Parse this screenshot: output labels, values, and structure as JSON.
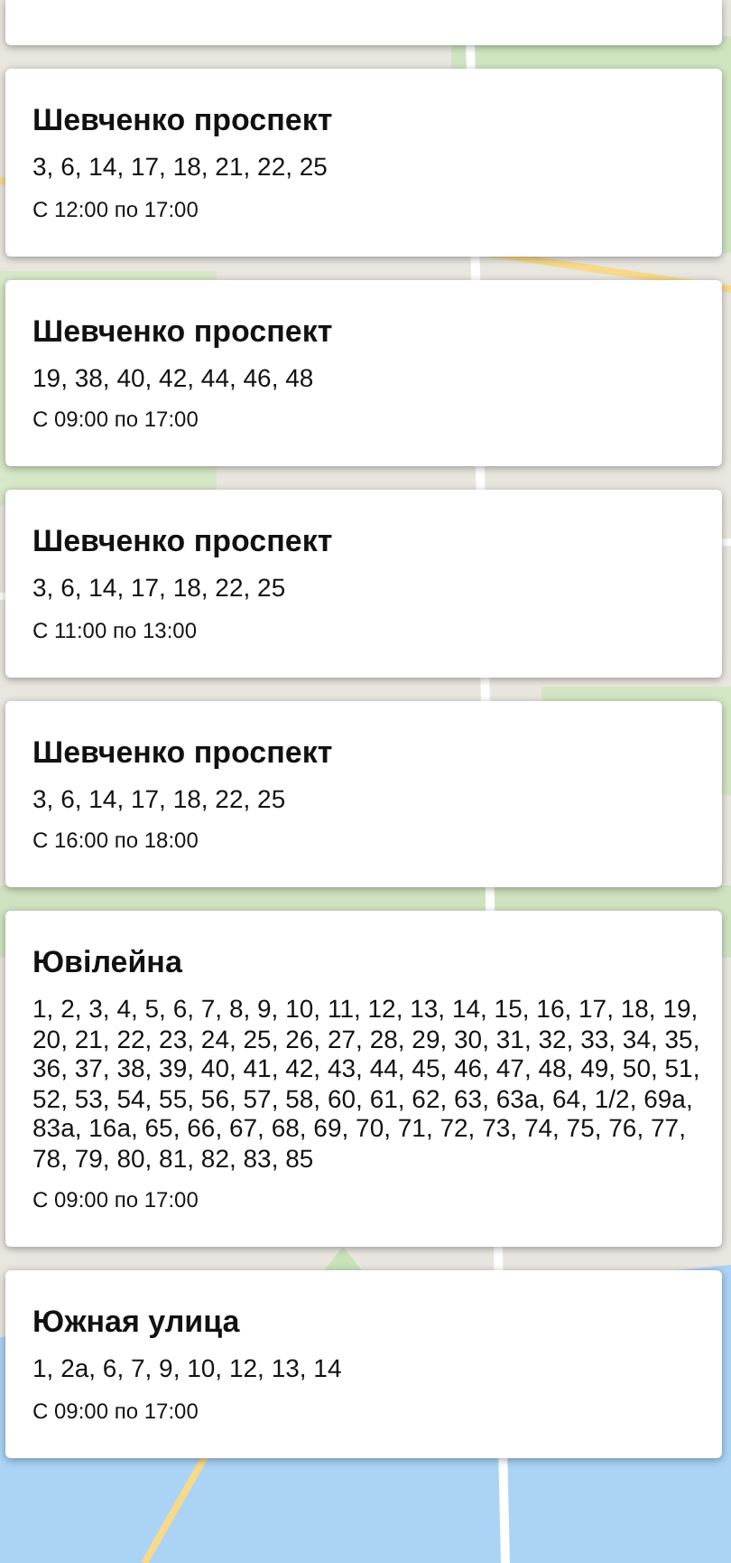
{
  "cards": [
    {
      "title": "Шевченко проспект",
      "houses": "3, 6, 14, 17, 18, 21, 22, 25",
      "time": "С 12:00 по 17:00"
    },
    {
      "title": "Шевченко проспект",
      "houses": "19, 38, 40, 42, 44, 46, 48",
      "time": "С 09:00 по 17:00"
    },
    {
      "title": "Шевченко проспект",
      "houses": "3, 6, 14, 17, 18, 22, 25",
      "time": "С 11:00 по 13:00"
    },
    {
      "title": "Шевченко проспект",
      "houses": "3, 6, 14, 17, 18, 22, 25",
      "time": "С 16:00 по 18:00"
    },
    {
      "title": "Ювілейна",
      "houses": "1, 2, 3, 4, 5, 6, 7, 8, 9, 10, 11, 12, 13, 14, 15, 16, 17, 18, 19, 20, 21, 22, 23, 24, 25, 26, 27, 28, 29, 30, 31, 32, 33, 34, 35, 36, 37, 38, 39, 40, 41, 42, 43, 44, 45, 46, 47, 48, 49, 50, 51, 52, 53, 54, 55, 56, 57, 58, 60, 61, 62, 63, 63а, 64, 1/2, 69а, 83а, 16а, 65, 66, 67, 68, 69, 70, 71, 72, 73, 74, 75, 76, 77, 78, 79, 80, 81, 82, 83, 85",
      "time": "С 09:00 по 17:00"
    },
    {
      "title": "Южная улица",
      "houses": "1, 2а, 6, 7, 9, 10, 12, 13, 14",
      "time": "С 09:00 по 17:00"
    }
  ]
}
